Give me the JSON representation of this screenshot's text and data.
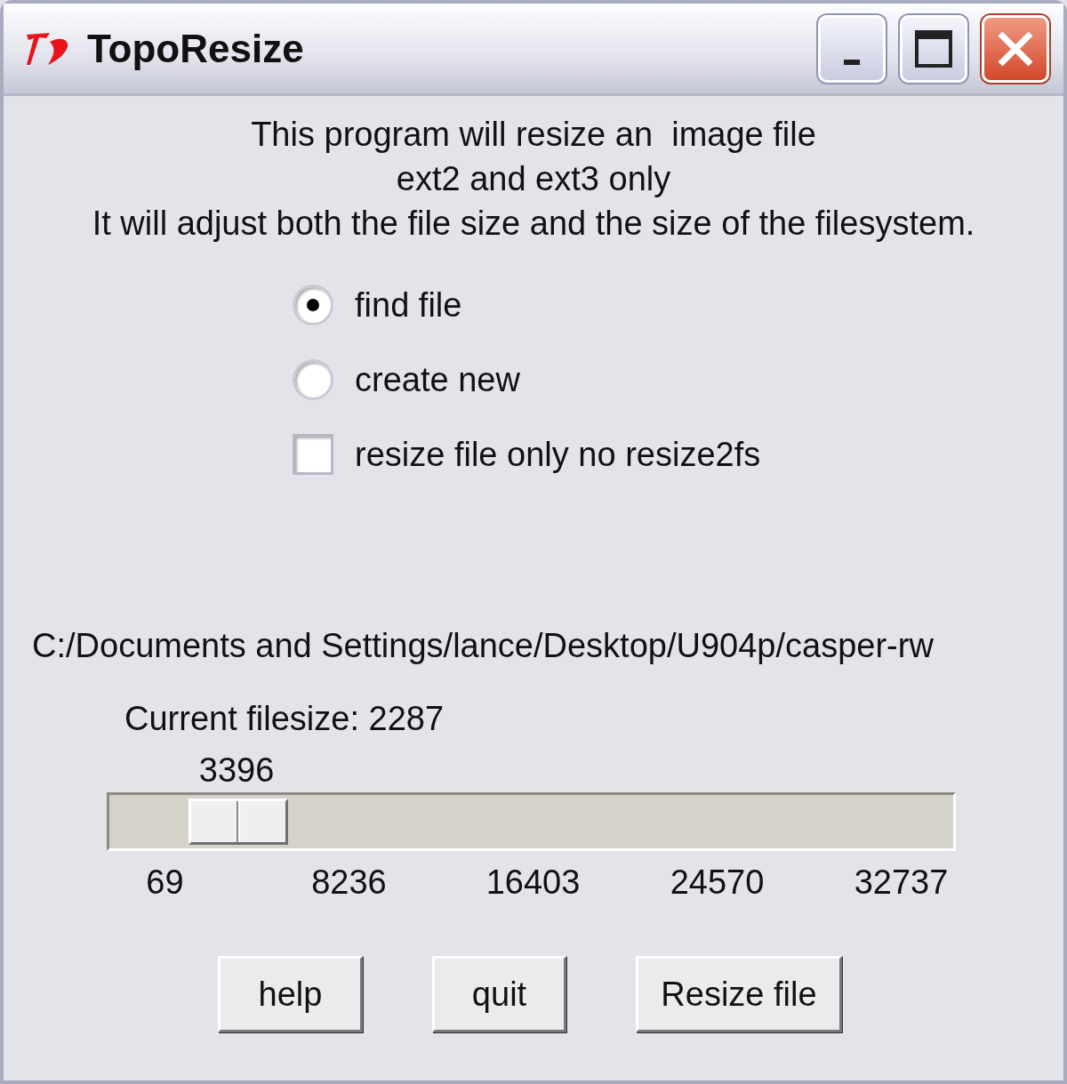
{
  "window": {
    "title": "TopoResize"
  },
  "intro": [
    "This program will resize an  image file",
    "ext2 and ext3 only",
    "It will adjust both the file size and the size of the filesystem."
  ],
  "options": [
    {
      "kind": "radio",
      "label": "find file",
      "selected": true
    },
    {
      "kind": "radio",
      "label": "create new",
      "selected": false
    },
    {
      "kind": "checkbox",
      "label": "resize file only no resize2fs",
      "checked": false
    }
  ],
  "path": "C:/Documents and Settings/lance/Desktop/U904p/casper-rw",
  "current_filesize": "Current filesize: 2287",
  "slider": {
    "reading": "3396",
    "ticks": [
      "69",
      "8236",
      "16403",
      "24570",
      "32737"
    ]
  },
  "buttons": [
    "help",
    "quit",
    "Resize file"
  ]
}
